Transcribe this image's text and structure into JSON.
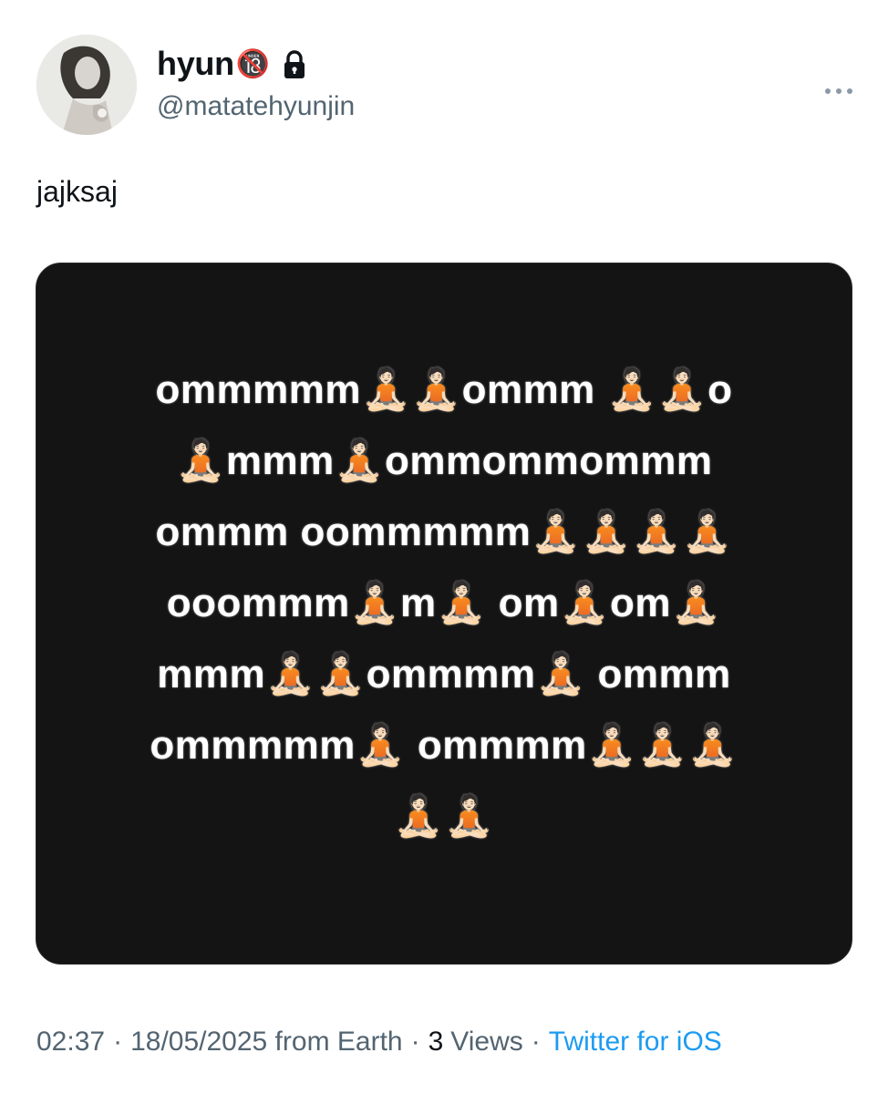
{
  "user": {
    "display_name": "hyun",
    "name_emoji": "🔞",
    "handle": "@matatehyunjin",
    "protected_icon": "lock-icon",
    "avatar_icon": "avatar-photo"
  },
  "tweet": {
    "text": "jajksaj",
    "more_icon": "more-horizontal-icon"
  },
  "media": {
    "lines": [
      "ommmmm🧘🏻🧘🏻ommm 🧘🏻🧘🏻o",
      "🧘🏻mmm🧘🏻ommommommm",
      "ommm oommmmm🧘🏻🧘🏻🧘🏻🧘🏻",
      "ooommm🧘🏻m🧘🏻 om🧘🏻om🧘🏻",
      "mmm🧘🏻🧘🏻ommmm🧘🏻 ommm",
      "ommmmm🧘🏻 ommmm🧘🏻🧘🏻🧘🏻",
      "🧘🏻🧘🏻"
    ]
  },
  "meta": {
    "time": "02:37",
    "date_location": "18/05/2025 from Earth",
    "views_count": "3",
    "views_label": "Views",
    "source": "Twitter for iOS",
    "separator": "·"
  },
  "colors": {
    "text": "#0f1419",
    "secondary": "#536471",
    "link": "#1d9bf0",
    "media_bg": "#141414"
  }
}
